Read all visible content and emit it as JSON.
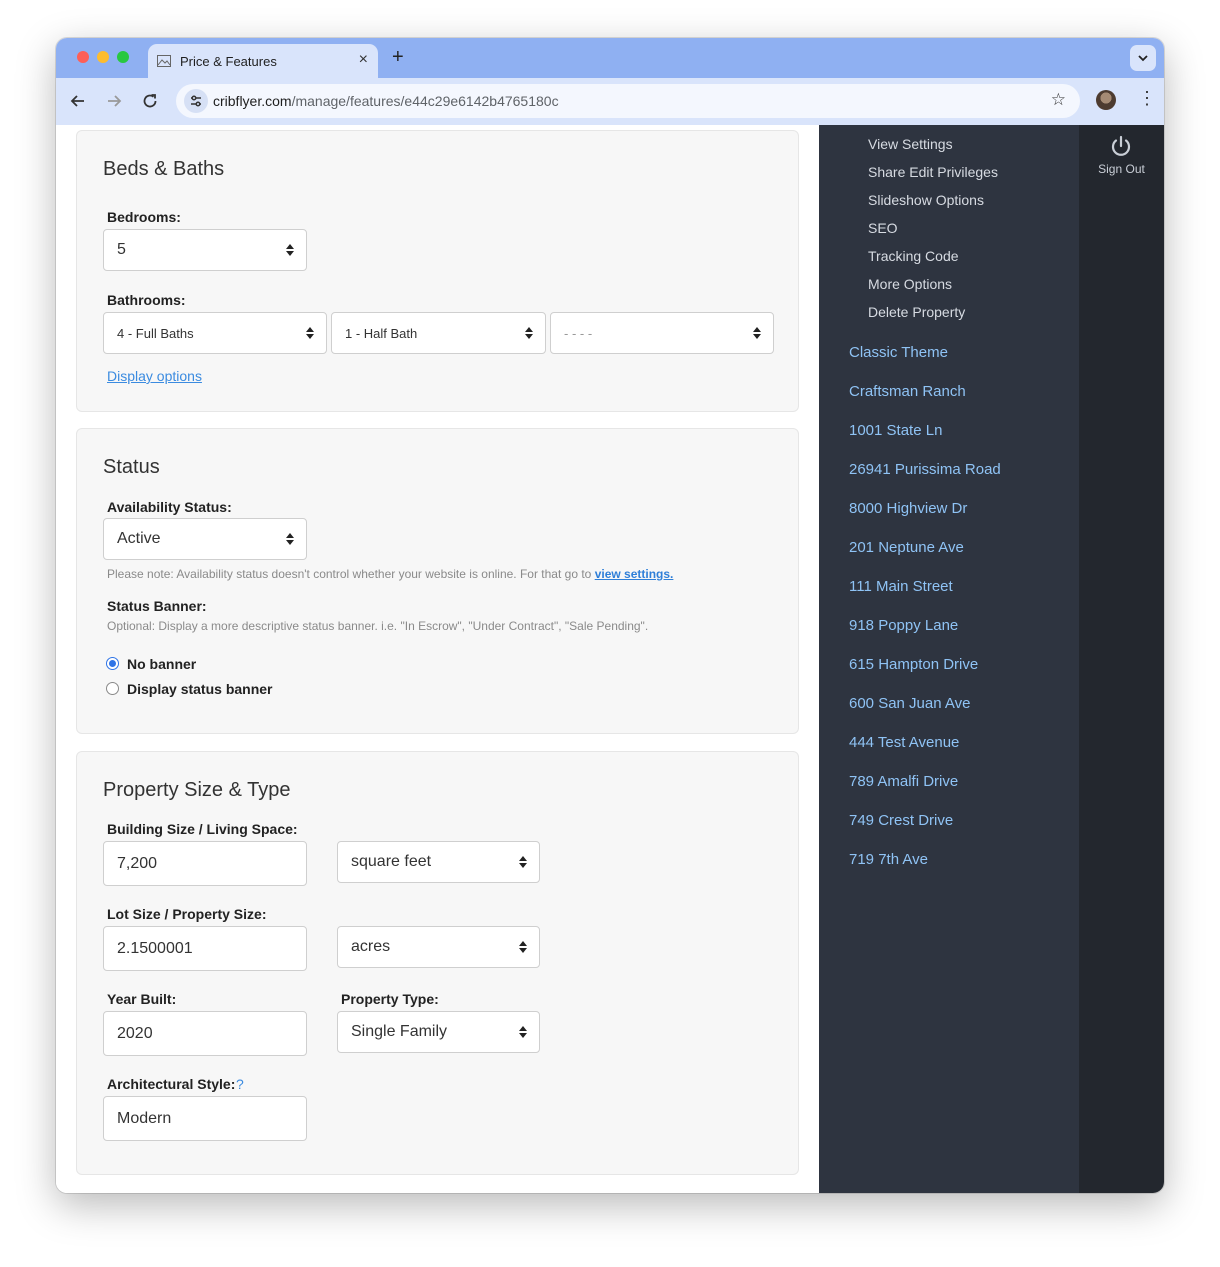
{
  "browser": {
    "tab_title": "Price & Features",
    "url_host": "cribflyer.com",
    "url_path": "/manage/features/e44c29e6142b4765180c"
  },
  "beds_baths": {
    "heading": "Beds & Baths",
    "bedrooms_label": "Bedrooms:",
    "bedrooms_value": "5",
    "bathrooms_label": "Bathrooms:",
    "full_baths": "4 - Full Baths",
    "half_baths": "1 - Half Bath",
    "other_baths": "- - - -",
    "display_options": "Display options"
  },
  "status": {
    "heading": "Status",
    "availability_label": "Availability Status:",
    "availability_value": "Active",
    "note_text": "Please note: Availability status doesn't control whether your website is online. For that go to ",
    "note_link": "view settings.",
    "banner_label": "Status Banner:",
    "banner_note": "Optional: Display a more descriptive status banner. i.e. \"In Escrow\", \"Under Contract\", \"Sale Pending\".",
    "radio_no_banner": "No banner",
    "radio_display_banner": "Display status banner",
    "selected_radio": "No banner"
  },
  "size_type": {
    "heading": "Property Size & Type",
    "building_label": "Building Size / Living Space:",
    "building_value": "7,200",
    "building_unit": "square feet",
    "lot_label": "Lot Size / Property Size:",
    "lot_value": "2.1500001",
    "lot_unit": "acres",
    "year_label": "Year Built:",
    "year_value": "2020",
    "type_label": "Property Type:",
    "type_value": "Single Family",
    "style_label": "Architectural Style:",
    "style_help": "?",
    "style_value": "Modern"
  },
  "sidebar": {
    "sub_items": [
      "View Settings",
      "Share Edit Privileges",
      "Slideshow Options",
      "SEO",
      "Tracking Code",
      "More Options",
      "Delete Property"
    ],
    "properties": [
      "Classic Theme",
      "Craftsman Ranch",
      "1001 State Ln",
      "26941 Purissima Road",
      "8000 Highview Dr",
      "201 Neptune Ave",
      "111 Main Street",
      "918 Poppy Lane",
      "615 Hampton Drive",
      "600 San Juan Ave",
      "444 Test Avenue",
      "789 Amalfi Drive",
      "749 Crest Drive",
      "719 7th Ave"
    ]
  },
  "account": {
    "sign_out": "Sign Out"
  },
  "colors": {
    "link": "#3b8be0",
    "sidebar_bg": "#2e3440",
    "sidebar_link": "#8fc3f5",
    "rightbar_bg": "#23272e",
    "tabbar_bg": "#8fb0f2"
  }
}
